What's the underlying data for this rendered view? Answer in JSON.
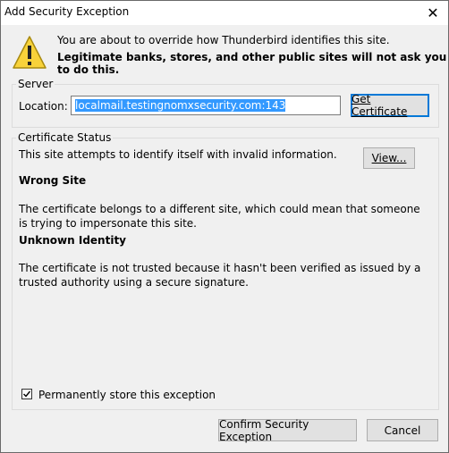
{
  "window": {
    "title": "Add Security Exception",
    "close_glyph": "✕"
  },
  "warning": {
    "icon": "warning-triangle-icon",
    "line1": "You are about to override how Thunderbird identifies this site.",
    "line2": "Legitimate banks, stores, and other public sites will not ask you to do this."
  },
  "server": {
    "legend": "Server",
    "location_label": "Location:",
    "location_value": "localmail.testingnomxsecurity.com:143",
    "get_certificate_label": "Get Certificate"
  },
  "status": {
    "legend": "Certificate Status",
    "intro": "This site attempts to identify itself with invalid information.",
    "view_label": "View...",
    "wrong_site_heading": "Wrong Site",
    "wrong_site_body": "The certificate belongs to a different site, which could mean that someone is trying to impersonate this site.",
    "unknown_heading": "Unknown Identity",
    "unknown_body": "The certificate is not trusted because it hasn't been verified as issued by a trusted authority using a secure signature."
  },
  "permanent": {
    "label": "Permanently store this exception",
    "checked": true
  },
  "footer": {
    "confirm_label": "Confirm Security Exception",
    "cancel_label": "Cancel"
  }
}
